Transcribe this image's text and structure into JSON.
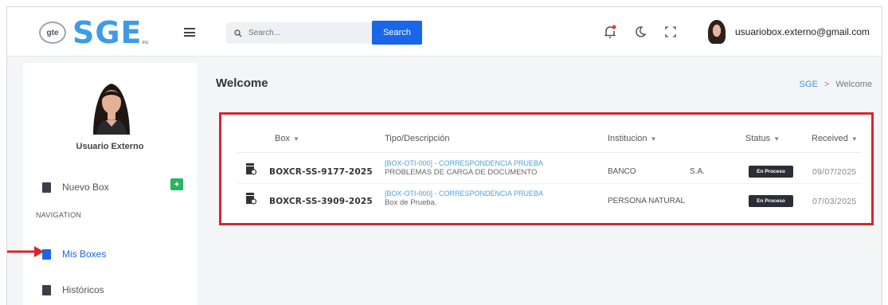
{
  "header": {
    "logo_badge": "gte",
    "logo_text": "SGE",
    "logo_sub": "Inc",
    "search_placeholder": "Search...",
    "search_button": "Search",
    "user_email": "usuariobox.externo@gmail.com"
  },
  "sidebar": {
    "user_name": "Usuario Externo",
    "new_box_label": "Nuevo Box",
    "new_box_badge": "+",
    "navigation_heading": "NAVIGATION",
    "items": [
      {
        "label": "Mis Boxes",
        "active": true
      },
      {
        "label": "Históricos",
        "active": false
      }
    ]
  },
  "page": {
    "title": "Welcome",
    "breadcrumb": {
      "root": "SGE",
      "separator": ">",
      "current": "Welcome"
    }
  },
  "table": {
    "columns": [
      "Box",
      "Tipo/Descripción",
      "Institucion",
      "Status",
      "Received"
    ],
    "rows": [
      {
        "box": "BOXCR-SS-9177-2025",
        "tipo": "[BOX-OTI-000] - CORRESPONDENCIA PRUEBA",
        "descripcion": "PROBLEMAS DE CARGA DE DOCUMENTO",
        "institucion": "BANCO",
        "institucion_suffix": "S.A.",
        "status": "En Proceso",
        "received": "09/07/2025"
      },
      {
        "box": "BOXCR-SS-3909-2025",
        "tipo": "[BOX-OTI-000] - CORRESPONDENCIA PRUEBA",
        "descripcion": "Box de Prueba.",
        "institucion": "PERSONA NATURAL",
        "institucion_suffix": "",
        "status": "En Proceso",
        "received": "07/03/2025"
      }
    ]
  },
  "colors": {
    "accent": "#1a66e8",
    "logo": "#3f9ae8",
    "highlight_border": "#d7262c",
    "new_badge": "#28b463",
    "status_badge": "#2a2f36"
  }
}
